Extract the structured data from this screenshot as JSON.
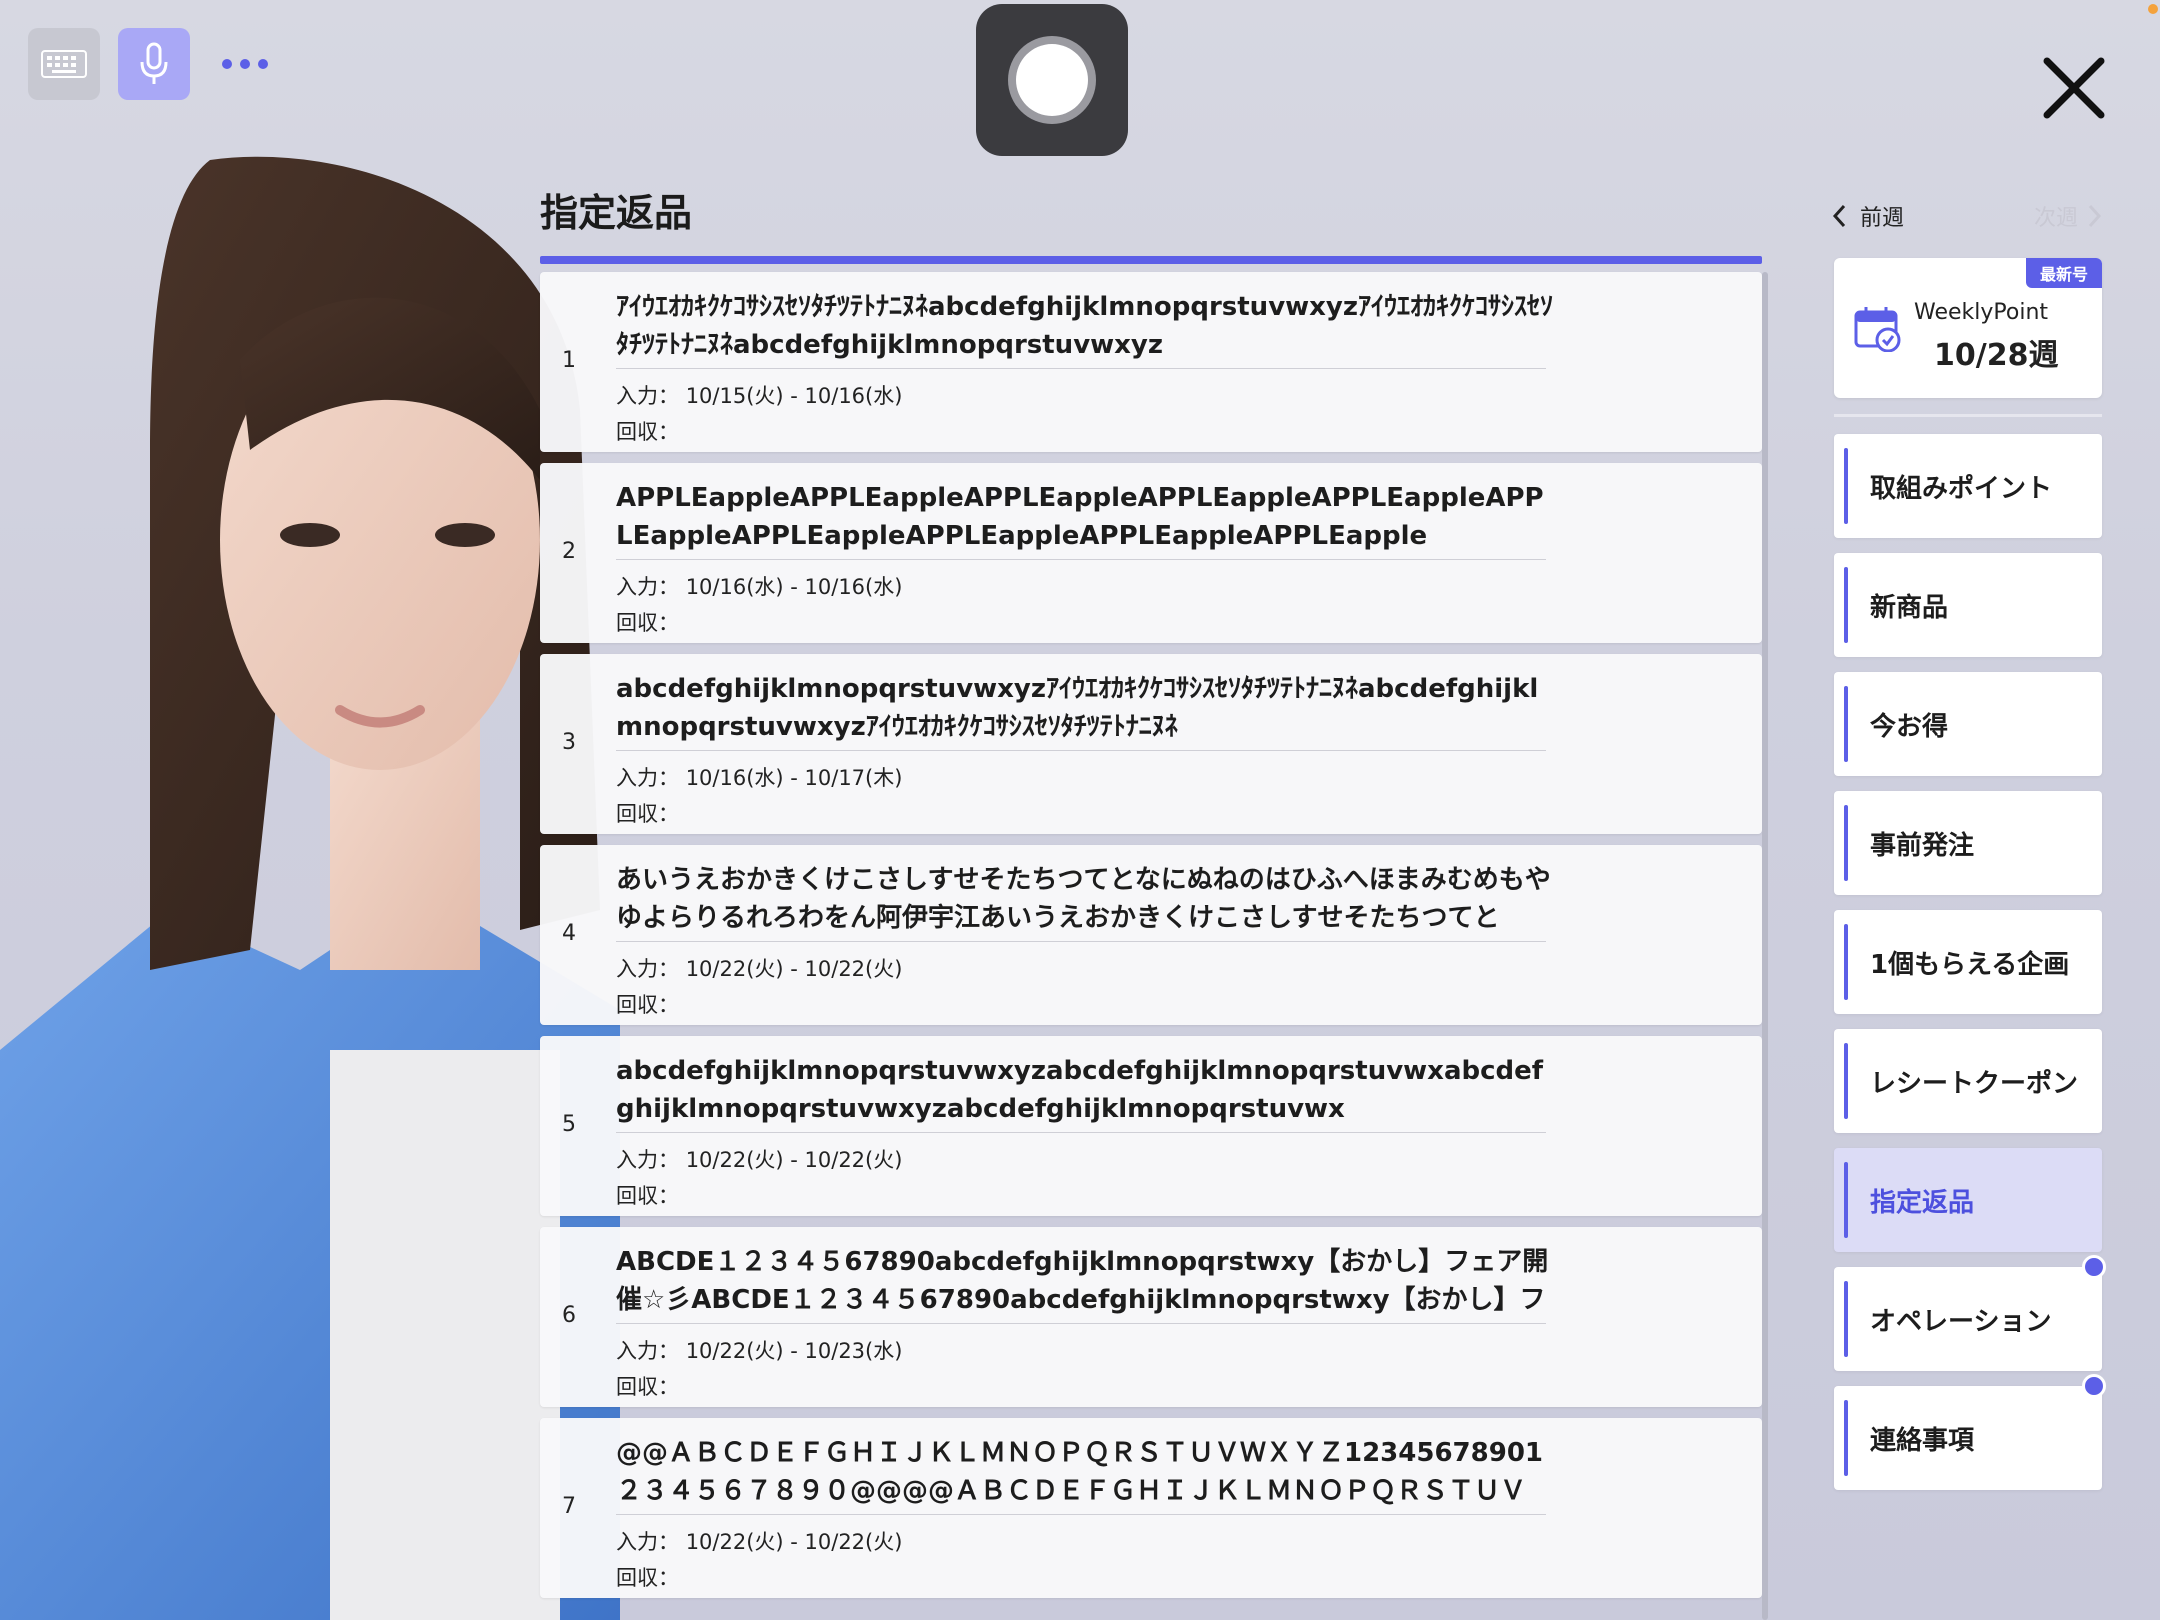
{
  "page": {
    "title": "指定返品"
  },
  "toolbar": {
    "keyboard_icon": "keyboard-icon",
    "mic_icon": "microphone-icon",
    "more_icon": "more-dots-icon",
    "record_icon": "record-button-icon",
    "close_icon": "close-icon"
  },
  "returns": {
    "input_label": "入力：",
    "collect_label": "回収：",
    "items": [
      {
        "no": "1",
        "title": "ｱｲｳｴｵｶｷｸｹｺｻｼｽｾｿﾀﾁﾂﾃﾄﾅﾆﾇﾈabcdefghijklmnopqrstuvwxyzｱｲｳｴｵｶｷｸｹｺｻｼｽｾｿﾀﾁﾂﾃﾄﾅﾆﾇﾈabcdefghijklmnopqrstuvwxyz",
        "input": "10/15(火) - 10/16(水)",
        "collect": ""
      },
      {
        "no": "2",
        "title": "APPLEappleAPPLEappleAPPLEappleAPPLEappleAPPLEappleAPPLEappleAPPLEappleAPPLEappleAPPLEappleAPPLEapple",
        "input": "10/16(水) - 10/16(水)",
        "collect": ""
      },
      {
        "no": "3",
        "title": "abcdefghijklmnopqrstuvwxyzｱｲｳｴｵｶｷｸｹｺｻｼｽｾｿﾀﾁﾂﾃﾄﾅﾆﾇﾈabcdefghijklmnopqrstuvwxyzｱｲｳｴｵｶｷｸｹｺｻｼｽｾｿﾀﾁﾂﾃﾄﾅﾆﾇﾈ",
        "input": "10/16(水) - 10/17(木)",
        "collect": ""
      },
      {
        "no": "4",
        "title": "あいうえおかきくけこさしすせそたちつてとなにぬねのはひふへほまみむめもやゆよらりるれろわをん阿伊宇江あいうえおかきくけこさしすせそたちつてと",
        "input": "10/22(火) - 10/22(火)",
        "collect": ""
      },
      {
        "no": "5",
        "title": "abcdefghijklmnopqrstuvwxyzabcdefghijklmnopqrstuvwxabcdefghijklmnopqrstuvwxyzabcdefghijklmnopqrstuvwx",
        "input": "10/22(火) - 10/22(火)",
        "collect": ""
      },
      {
        "no": "6",
        "title": "ABCDE１２３４５67890abcdefghijklmnopqrstwxy【おかし】フェア開催☆彡ABCDE１２３４５67890abcdefghijklmnopqrstwxy【おかし】フェア開催",
        "input": "10/22(火) - 10/23(水)",
        "collect": ""
      },
      {
        "no": "7",
        "title": "@@ＡＢＣＤＥＦＧＨＩＪＫＬＭＮＯＰＱＲＳＴＵＶＷＸＹＺ12345678901２３４５６７８９０@@@@ＡＢＣＤＥＦＧＨＩＪＫＬＭＮＯＰＱＲＳＴＵＶ",
        "input": "10/22(火) - 10/22(火)",
        "collect": ""
      }
    ]
  },
  "sidebar": {
    "prev_week": "前週",
    "next_week": "次週",
    "weekly": {
      "badge": "最新号",
      "label": "WeeklyPoint",
      "date": "10/28週",
      "icon": "calendar-check-icon"
    },
    "menu": [
      {
        "label": "取組みポイント",
        "active": false,
        "dot": false
      },
      {
        "label": "新商品",
        "active": false,
        "dot": false
      },
      {
        "label": "今お得",
        "active": false,
        "dot": false
      },
      {
        "label": "事前発注",
        "active": false,
        "dot": false
      },
      {
        "label": "1個もらえる企画",
        "active": false,
        "dot": false
      },
      {
        "label": "レシートクーポン",
        "active": false,
        "dot": false
      },
      {
        "label": "指定返品",
        "active": true,
        "dot": false
      },
      {
        "label": "オペレーション",
        "active": false,
        "dot": true
      },
      {
        "label": "連絡事項",
        "active": false,
        "dot": true
      }
    ]
  },
  "colors": {
    "accent": "#5c5fe7",
    "mic_bg": "#a9a8f6",
    "record_bg": "#3b3b3f"
  }
}
